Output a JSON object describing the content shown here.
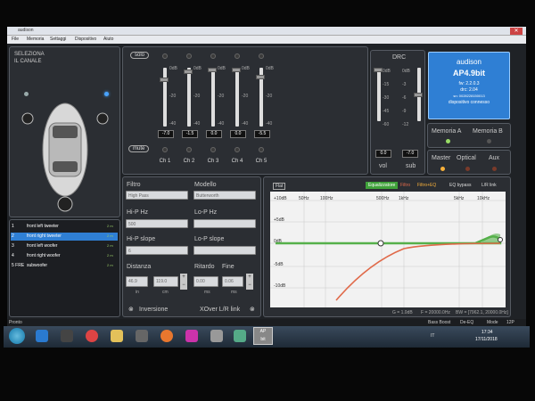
{
  "window": {
    "title": "audison",
    "menu": [
      "File",
      "Memoria",
      "Settaggi",
      "Dispositivo",
      "Aiuto"
    ]
  },
  "channel_select": {
    "title_line1": "SELEZIONA",
    "title_line2": "IL CANALE",
    "link_label": "link",
    "channels": [
      {
        "num": "1",
        "name": "front left tweeter",
        "tag": "2 m"
      },
      {
        "num": "2",
        "name": "front right tweeter",
        "tag": "2 m"
      },
      {
        "num": "3",
        "name": "front left woofer",
        "tag": "2 m"
      },
      {
        "num": "4",
        "name": "front right woofer",
        "tag": "2 m"
      },
      {
        "num": "5 FRE",
        "name": "subwoofer",
        "tag": "2 m"
      }
    ],
    "selected_index": 1
  },
  "mixer": {
    "solo_label": "solo",
    "mute_label": "mute",
    "scale": [
      "0dB",
      "-20",
      "-40"
    ],
    "channels": [
      {
        "name": "Ch 1",
        "value": "-7.0",
        "level": 0.82
      },
      {
        "name": "Ch 2",
        "value": "-1.5",
        "level": 0.96
      },
      {
        "name": "Ch 3",
        "value": "0.0",
        "level": 1.0
      },
      {
        "name": "Ch 4",
        "value": "0.0",
        "level": 1.0
      },
      {
        "name": "Ch 5",
        "value": "-5.5",
        "level": 0.86
      }
    ]
  },
  "drc": {
    "title": "DRC",
    "vol_scale": [
      "0dB",
      "-15",
      "-30",
      "-45",
      "-60"
    ],
    "sub_scale": [
      "0dB",
      "-3",
      "-6",
      "-9",
      "-12"
    ],
    "vol_value": "0.0",
    "sub_value": "-7.0",
    "vol_label": "vol",
    "sub_label": "sub"
  },
  "device": {
    "name": "audison",
    "model": "AP4.9bit",
    "fw": "fw: 2.2.0.3",
    "drc": "drc: 2.04",
    "sn": "sn: 0028228150013",
    "status": "dispositivo connesso"
  },
  "memory": {
    "a": "Memoria A",
    "b": "Memoria B"
  },
  "source": {
    "master": "Master",
    "optical": "Optical",
    "aux": "Aux"
  },
  "filter": {
    "filtro_label": "Filtro",
    "filtro_value": "High Pass",
    "modello_label": "Modello",
    "modello_value": "Butterworth",
    "hip_hz_label": "Hi-P Hz",
    "hip_hz_value": "500",
    "lop_hz_label": "Lo-P Hz",
    "hip_slope_label": "Hi-P slope",
    "hip_slope_value": "6",
    "lop_slope_label": "Lo-P slope",
    "distanza_label": "Distanza",
    "distanza_in": "46.9",
    "distanza_cm": "119.0",
    "in_label": "in",
    "cm_label": "cm",
    "ritardo_label": "Ritardo",
    "fine_label": "Fine",
    "ritardo_value": "0.00",
    "fine_value": "0.06",
    "ms_label": "ms",
    "inversione_label": "Inversione",
    "xover_label": "XOver L/R link"
  },
  "eq": {
    "flat_label": "Flat",
    "equalizzatore_label": "Equalizzatore",
    "filtro_label": "Filtro",
    "filtro_eq_label": "Filtro+EQ",
    "eq_bypass_label": "EQ bypass",
    "lr_link_label": "L/R link",
    "freq_labels": [
      "50Hz",
      "100Hz",
      "500Hz",
      "1kHz",
      "5kHz",
      "10kHz"
    ],
    "db_labels": [
      "+10dB",
      "+5dB",
      "0dB",
      "-5dB",
      "-10dB"
    ],
    "readout_g": "G = 1.0dB",
    "readout_f": "F = 20000.0Hz",
    "readout_bw": "BW = [7962.1, 20000.0Hz]",
    "colors": {
      "filter": "#e06a4a",
      "eq": "#55b04a",
      "equalizzatore_bg": "#3fa23a"
    }
  },
  "statusbar": {
    "left": "Pronto",
    "bass_boost": "Bass Boost",
    "de_eq": "De-EQ",
    "mode": "Mode",
    "mode_value": "12P"
  },
  "taskbar": {
    "lang": "IT",
    "time": "17:34",
    "date": "17/11/2018",
    "app_label": "AP\nbit"
  }
}
